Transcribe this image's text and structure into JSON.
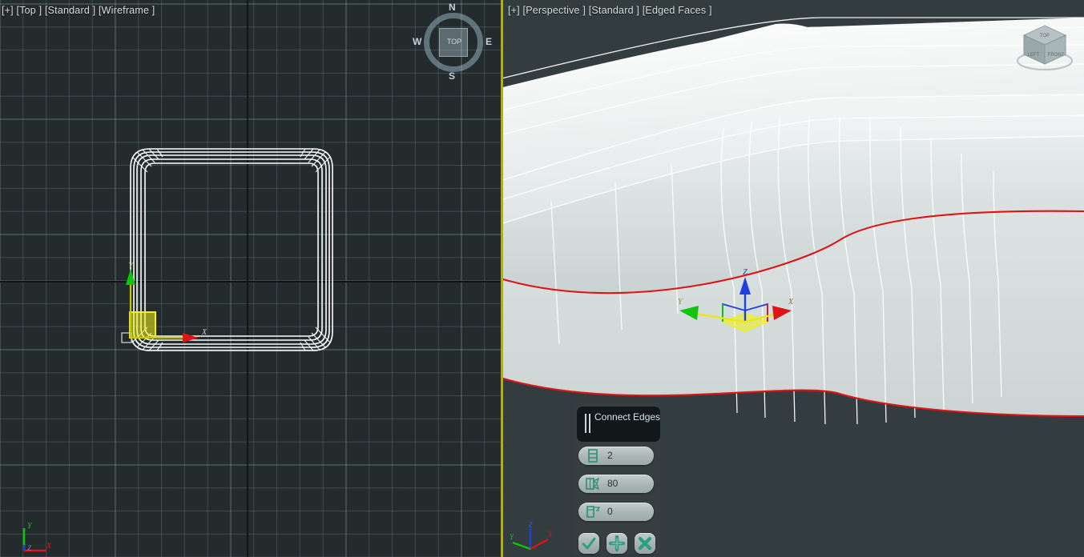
{
  "viewports": {
    "top": {
      "label": "[+] [Top ] [Standard ] [Wireframe ]",
      "name": "Top",
      "shading": "Wireframe",
      "style": "Standard",
      "axis_tripod": {
        "x": "X",
        "y": "Y",
        "z": "Z"
      },
      "gizmo": {
        "x": "X",
        "y": "Y"
      },
      "viewcube": {
        "face_label": "TOP",
        "compass": {
          "n": "N",
          "e": "E",
          "s": "S",
          "w": "W"
        }
      }
    },
    "perspective": {
      "label": "[+] [Perspective ] [Standard ] [Edged Faces ]",
      "name": "Perspective",
      "shading": "Edged Faces",
      "style": "Standard",
      "axis_tripod": {
        "x": "X",
        "y": "Y",
        "z": "Z"
      },
      "gizmo": {
        "x": "X",
        "y": "Y",
        "z": "Z"
      },
      "viewcube": {
        "faces": {
          "top": "TOP",
          "left": "LEFT",
          "front": "FRONT"
        }
      }
    }
  },
  "caddy": {
    "title": "Connect Edges",
    "fields": [
      {
        "name": "segments",
        "icon": "segments-icon",
        "value": "2"
      },
      {
        "name": "pinch",
        "icon": "pinch-icon",
        "value": "80"
      },
      {
        "name": "slide",
        "icon": "slide-icon",
        "value": "0"
      }
    ],
    "buttons": [
      {
        "name": "ok",
        "icon": "check-icon"
      },
      {
        "name": "apply",
        "icon": "plus-icon"
      },
      {
        "name": "cancel",
        "icon": "cross-icon"
      }
    ]
  },
  "colors": {
    "viewport_top_bg": "#232b2d",
    "viewport_persp_bg": "#333c3e",
    "active_border": "#b5ae12",
    "selected_edge": "#e01414",
    "axis_x": "#e01414",
    "axis_y": "#10c410",
    "axis_z": "#1f3fe0",
    "gizmo_plane": "#f2f213",
    "caddy_accent": "#2e9e80",
    "caddy_title_text": "#cfe3f2"
  }
}
